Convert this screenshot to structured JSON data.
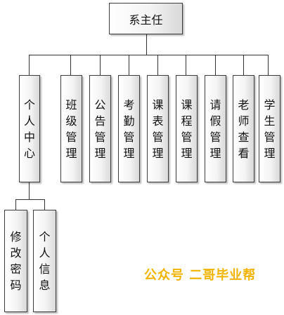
{
  "diagram": {
    "root": {
      "label": "系主任"
    },
    "modules": [
      {
        "id": "personal-center",
        "label": "个人中心",
        "children": [
          {
            "id": "change-password",
            "label": "修改密码"
          },
          {
            "id": "personal-info",
            "label": "个人信息"
          }
        ]
      },
      {
        "id": "class-management",
        "label": "班级管理"
      },
      {
        "id": "notice-management",
        "label": "公告管理"
      },
      {
        "id": "attendance-management",
        "label": "考勤管理"
      },
      {
        "id": "timetable-management",
        "label": "课表管理"
      },
      {
        "id": "course-management",
        "label": "课程管理"
      },
      {
        "id": "leave-management",
        "label": "请假管理"
      },
      {
        "id": "teacher-view",
        "label": "老师查看"
      },
      {
        "id": "student-management",
        "label": "学生管理"
      }
    ]
  },
  "watermark": {
    "text": "公众号 二哥毕业帮"
  }
}
